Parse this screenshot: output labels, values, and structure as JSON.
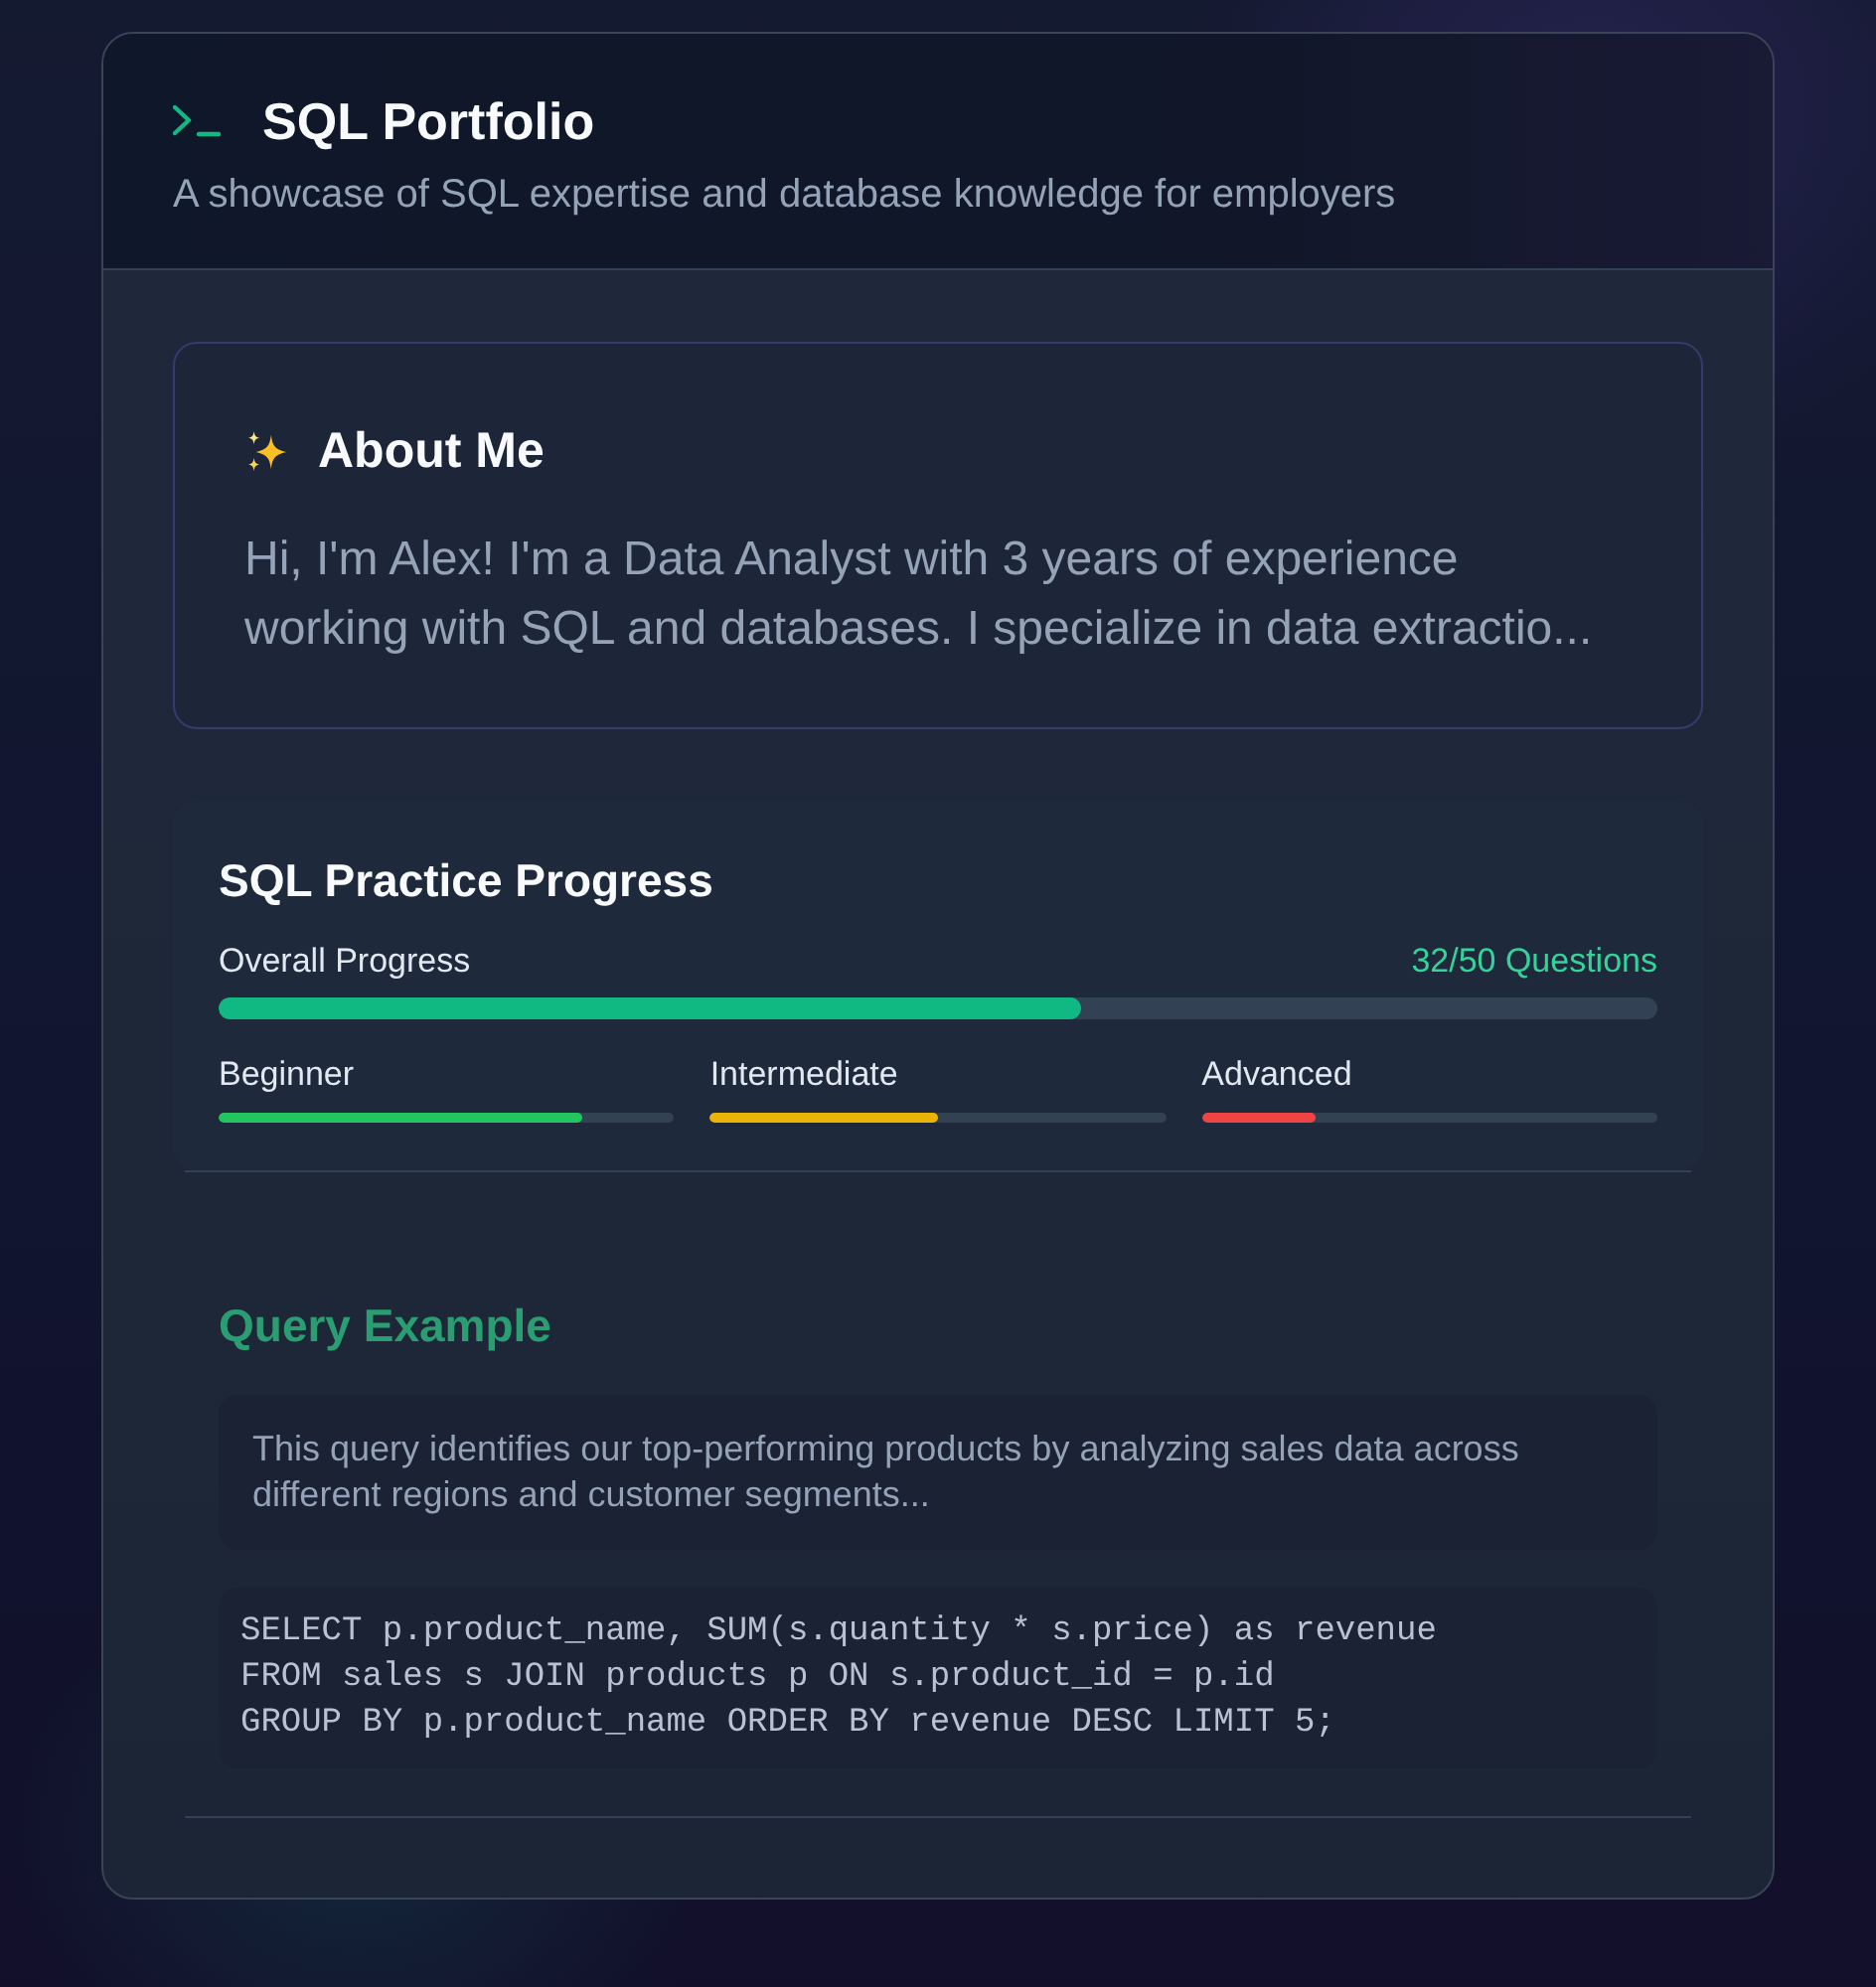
{
  "header": {
    "title": "SQL Portfolio",
    "subtitle": "A showcase of SQL expertise and database knowledge for employers"
  },
  "about": {
    "title": "About Me",
    "text": "Hi, I'm Alex! I'm a Data Analyst with 3 years of experience working with SQL and databases. I specialize in data extractio..."
  },
  "progress": {
    "title": "SQL Practice Progress",
    "overall": {
      "label": "Overall Progress",
      "count": "32/50 Questions",
      "level": 0.6
    },
    "levels": [
      {
        "label": "Beginner",
        "level": 0.8,
        "color": "#22c55e"
      },
      {
        "label": "Intermediate",
        "level": 0.5,
        "color": "#eab308"
      },
      {
        "label": "Advanced",
        "level": 0.25,
        "color": "#ef4444"
      }
    ]
  },
  "query_example": {
    "title": "Query Example",
    "description": "This query identifies our top-performing products by analyzing sales data across different regions and customer segments...",
    "code_lines": [
      "SELECT p.product_name, SUM(s.quantity * s.price) as revenue",
      "FROM sales s JOIN products p ON s.product_id = p.id",
      "GROUP BY p.product_name ORDER BY revenue DESC LIMIT 5;"
    ]
  }
}
